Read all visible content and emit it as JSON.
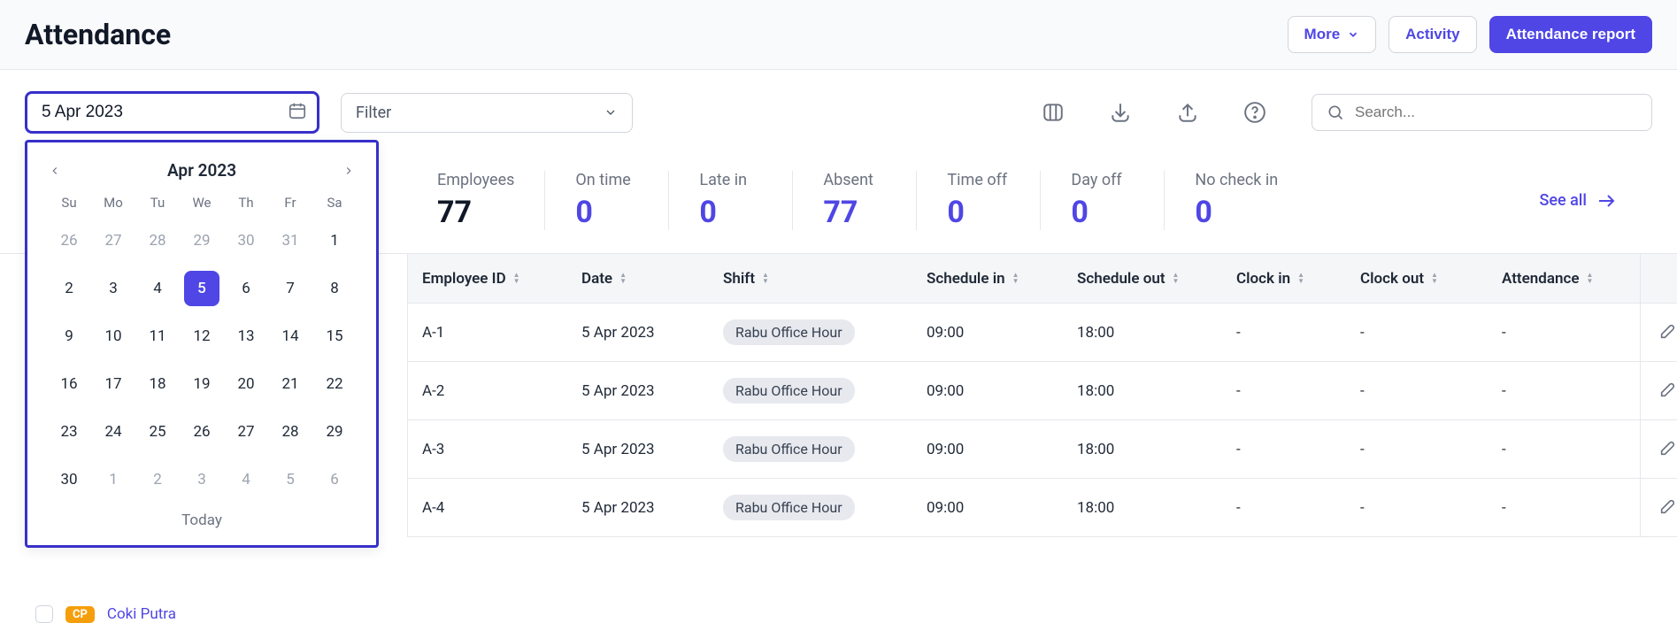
{
  "header": {
    "title": "Attendance",
    "more_label": "More",
    "activity_label": "Activity",
    "report_label": "Attendance report"
  },
  "controls": {
    "date_value": "5 Apr 2023",
    "filter_label": "Filter",
    "search_placeholder": "Search..."
  },
  "calendar": {
    "month_label": "Apr 2023",
    "dow": [
      "Su",
      "Mo",
      "Tu",
      "We",
      "Th",
      "Fr",
      "Sa"
    ],
    "weeks": [
      [
        {
          "d": "26",
          "m": true
        },
        {
          "d": "27",
          "m": true
        },
        {
          "d": "28",
          "m": true
        },
        {
          "d": "29",
          "m": true
        },
        {
          "d": "30",
          "m": true
        },
        {
          "d": "31",
          "m": true
        },
        {
          "d": "1"
        }
      ],
      [
        {
          "d": "2"
        },
        {
          "d": "3"
        },
        {
          "d": "4"
        },
        {
          "d": "5",
          "sel": true
        },
        {
          "d": "6"
        },
        {
          "d": "7"
        },
        {
          "d": "8"
        }
      ],
      [
        {
          "d": "9"
        },
        {
          "d": "10"
        },
        {
          "d": "11"
        },
        {
          "d": "12"
        },
        {
          "d": "13"
        },
        {
          "d": "14"
        },
        {
          "d": "15"
        }
      ],
      [
        {
          "d": "16"
        },
        {
          "d": "17"
        },
        {
          "d": "18"
        },
        {
          "d": "19"
        },
        {
          "d": "20"
        },
        {
          "d": "21"
        },
        {
          "d": "22"
        }
      ],
      [
        {
          "d": "23"
        },
        {
          "d": "24"
        },
        {
          "d": "25"
        },
        {
          "d": "26"
        },
        {
          "d": "27"
        },
        {
          "d": "28"
        },
        {
          "d": "29"
        }
      ],
      [
        {
          "d": "30"
        },
        {
          "d": "1",
          "m": true
        },
        {
          "d": "2",
          "m": true
        },
        {
          "d": "3",
          "m": true
        },
        {
          "d": "4",
          "m": true
        },
        {
          "d": "5",
          "m": true
        },
        {
          "d": "6",
          "m": true
        }
      ]
    ],
    "today_label": "Today"
  },
  "stats": [
    {
      "label": "Employees",
      "value": "77",
      "dark": true
    },
    {
      "label": "On time",
      "value": "0"
    },
    {
      "label": "Late in",
      "value": "0"
    },
    {
      "label": "Absent",
      "value": "77"
    },
    {
      "label": "Time off",
      "value": "0"
    },
    {
      "label": "Day off",
      "value": "0"
    },
    {
      "label": "No check in",
      "value": "0"
    }
  ],
  "see_all_label": "See all",
  "table": {
    "columns": [
      "Employee ID",
      "Date",
      "Shift",
      "Schedule in",
      "Schedule out",
      "Clock in",
      "Clock out",
      "Attendance"
    ],
    "rows": [
      {
        "id": "A-1",
        "date": "5 Apr 2023",
        "shift": "Rabu Office Hour",
        "sin": "09:00",
        "sout": "18:00",
        "cin": "-",
        "cout": "-",
        "att": "-"
      },
      {
        "id": "A-2",
        "date": "5 Apr 2023",
        "shift": "Rabu Office Hour",
        "sin": "09:00",
        "sout": "18:00",
        "cin": "-",
        "cout": "-",
        "att": "-"
      },
      {
        "id": "A-3",
        "date": "5 Apr 2023",
        "shift": "Rabu Office Hour",
        "sin": "09:00",
        "sout": "18:00",
        "cin": "-",
        "cout": "-",
        "att": "-"
      },
      {
        "id": "A-4",
        "date": "5 Apr 2023",
        "shift": "Rabu Office Hour",
        "sin": "09:00",
        "sout": "18:00",
        "cin": "-",
        "cout": "-",
        "att": "-"
      }
    ]
  },
  "left_employee": {
    "initials": "CP",
    "name": "Coki Putra"
  }
}
